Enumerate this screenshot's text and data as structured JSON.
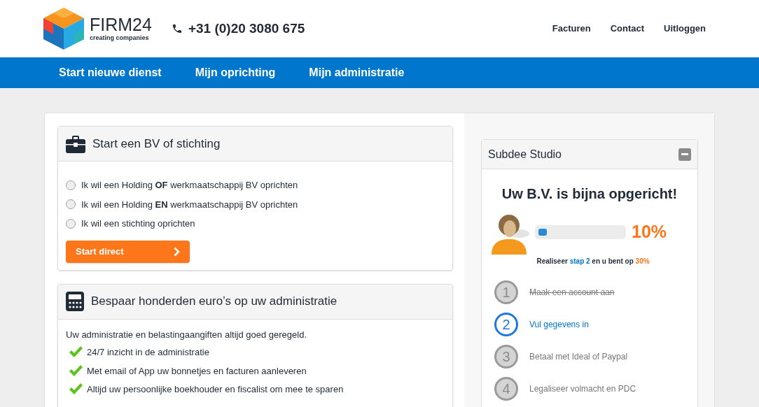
{
  "header": {
    "logo": {
      "name": "FIRM24",
      "tagline": "creating companies"
    },
    "phone": "+31 (0)20 3080 675",
    "links": [
      "Facturen",
      "Contact",
      "Uitloggen"
    ]
  },
  "nav": {
    "items": [
      {
        "label": "Start nieuwe dienst"
      },
      {
        "label": "Mijn oprichting"
      },
      {
        "label": "Mijn administratie"
      }
    ]
  },
  "start_card": {
    "title": "Start een BV of stichting",
    "options": [
      {
        "label": "Ik wil een Holding **OF** werkmaatschappij BV oprichten",
        "selected": false
      },
      {
        "label": "Ik wil een Holding **EN** werkmaatschappij BV oprichten",
        "selected": false
      },
      {
        "label": "Ik wil een stichting oprichten",
        "selected": false
      }
    ],
    "button": "Start direct"
  },
  "admin_card": {
    "title": "Bespaar honderden euro’s op uw administratie",
    "intro": "Uw administratie en belastingaangiften altijd goed geregeld.",
    "features": [
      "24/7 inzicht in de administratie",
      "Met email of App uw bonnetjes en facturen aanleveren",
      "Altijd uw persoonlijke boekhouder en fiscalist om mee te sparen"
    ]
  },
  "progress_panel": {
    "title": "Subdee Studio",
    "heading": "Uw B.V. is bijna opgericht!",
    "progress": {
      "level": 0.1,
      "reading": "10%"
    },
    "hint": {
      "before": "Realiseer",
      "link": "stap 2",
      "middle": "en u bent op",
      "target": "30%"
    },
    "steps": [
      {
        "number": "1",
        "label": "Maak een account aan",
        "kind": "done"
      },
      {
        "number": "2",
        "label": "Vul gegevens in",
        "kind": "current"
      },
      {
        "number": "3",
        "label": "Betaal met Ideal of Paypal",
        "kind": "todo"
      },
      {
        "number": "4",
        "label": "Legaliseer volmacht en PDC",
        "kind": "todo"
      }
    ]
  }
}
